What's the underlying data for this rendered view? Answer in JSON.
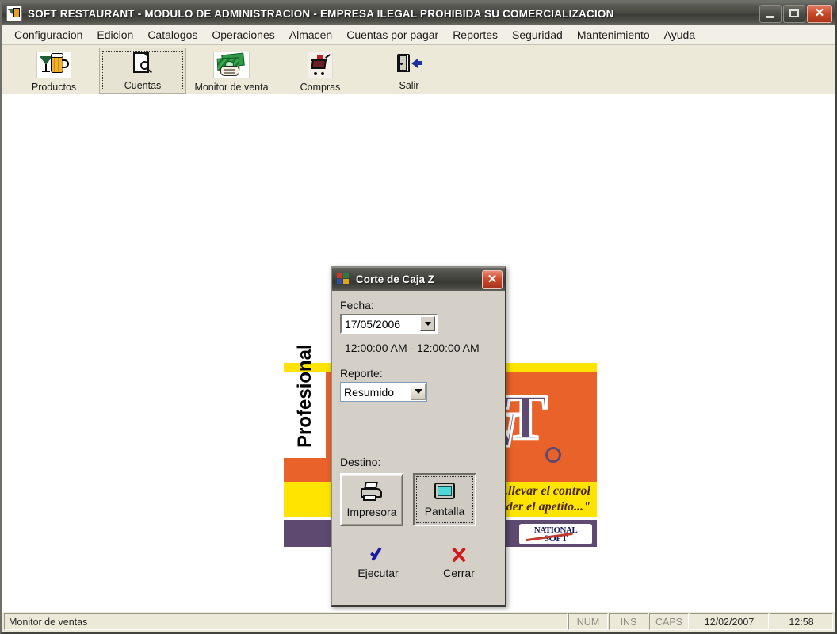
{
  "window": {
    "title": "SOFT RESTAURANT  -  MODULO DE ADMINISTRACION - EMPRESA ILEGAL PROHIBIDA SU COMERCIALIZACION",
    "icon": "restaurant-app-icon",
    "controls": {
      "minimize": "minimize-button",
      "maximize": "maximize-button",
      "close_glyph": "✕"
    }
  },
  "menu": {
    "items": [
      {
        "label": "Configuracion"
      },
      {
        "label": "Edicion"
      },
      {
        "label": "Catalogos"
      },
      {
        "label": "Operaciones"
      },
      {
        "label": "Almacen"
      },
      {
        "label": "Cuentas por pagar"
      },
      {
        "label": "Reportes"
      },
      {
        "label": "Seguridad"
      },
      {
        "label": "Mantenimiento"
      },
      {
        "label": "Ayuda"
      }
    ]
  },
  "toolbar": {
    "buttons": [
      {
        "label": "Productos",
        "icon": "drinks-icon",
        "focused": false
      },
      {
        "label": "Cuentas",
        "icon": "document-search-icon",
        "focused": true
      },
      {
        "label": "Monitor de venta",
        "icon": "money-hand-icon",
        "focused": false
      },
      {
        "label": "Compras",
        "icon": "shopping-cart-icon",
        "focused": false
      },
      {
        "label": "Salir",
        "icon": "exit-door-icon",
        "focused": false
      }
    ]
  },
  "splash": {
    "vertical_text": "Profesional",
    "brand_mark": {
      "letter_n": "N",
      "letter_t": "T"
    },
    "tagline_line1": "...llevar el control",
    "tagline_line2": "sin perder el apetito...\"",
    "logo_line1": "NATIONAL",
    "logo_line2": "SOFT",
    "colors": {
      "yellow": "#ffe400",
      "orange": "#e8622a",
      "purple": "#5e4a70"
    }
  },
  "dialog": {
    "title": "Corte de Caja Z",
    "icon": "windows-flag-icon",
    "close_glyph": "✕",
    "fecha_label": "Fecha:",
    "fecha_value": "17/05/2006",
    "time_range": "12:00:00 AM - 12:00:00 AM",
    "reporte_label": "Reporte:",
    "reporte_value": "Resumido",
    "destino_label": "Destino:",
    "destino": [
      {
        "label": "Impresora",
        "icon": "printer-icon",
        "selected": false
      },
      {
        "label": "Pantalla",
        "icon": "monitor-icon",
        "selected": true
      }
    ],
    "actions": [
      {
        "label": "Ejecutar",
        "icon": "checkmark-icon",
        "color": "#1a1aa8"
      },
      {
        "label": "Cerrar",
        "icon": "cross-icon",
        "color": "#d11a1a"
      }
    ]
  },
  "status_bar": {
    "message": "Monitor de ventas",
    "num": "NUM",
    "ins": "INS",
    "caps": "CAPS",
    "date": "12/02/2007",
    "time": "12:58"
  }
}
